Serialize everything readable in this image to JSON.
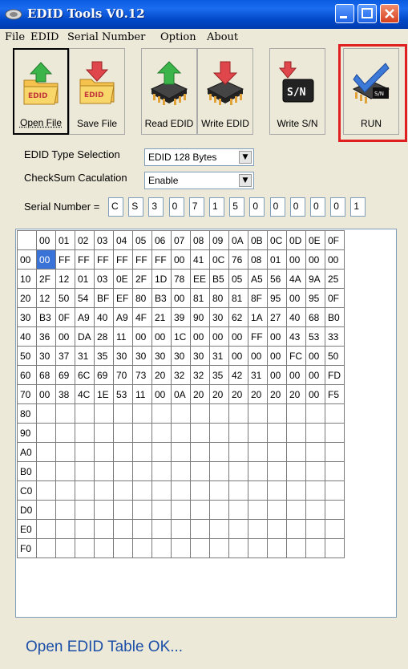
{
  "window": {
    "title": "EDID Tools V0.12"
  },
  "menu": [
    "File",
    "EDID",
    "Serial Number",
    "Option",
    "About"
  ],
  "toolbar": [
    {
      "label": "Open File",
      "icon": "folder-edid-up-icon"
    },
    {
      "label": "Save File",
      "icon": "folder-edid-down-icon"
    },
    {
      "label": "Read EDID",
      "icon": "chip-up-icon"
    },
    {
      "label": "Write EDID",
      "icon": "chip-down-icon"
    },
    {
      "label": "Write S/N",
      "icon": "sn-write-icon"
    },
    {
      "label": "RUN",
      "icon": "run-check-icon"
    }
  ],
  "form": {
    "edid_type_label": "EDID Type Selection",
    "edid_type_value": "EDID 128 Bytes",
    "checksum_label": "CheckSum Caculation",
    "checksum_value": "Enable",
    "serial_label": "Serial Number =",
    "serial_chars": [
      "C",
      "S",
      "3",
      "0",
      "7",
      "1",
      "5",
      "0",
      "0",
      "0",
      "0",
      "0",
      "1"
    ]
  },
  "table": {
    "col_headers": [
      "00",
      "01",
      "02",
      "03",
      "04",
      "05",
      "06",
      "07",
      "08",
      "09",
      "0A",
      "0B",
      "0C",
      "0D",
      "0E",
      "0F"
    ],
    "row_headers": [
      "00",
      "10",
      "20",
      "30",
      "40",
      "50",
      "60",
      "70",
      "80",
      "90",
      "A0",
      "B0",
      "C0",
      "D0",
      "E0",
      "F0"
    ],
    "rows": [
      [
        "00",
        "FF",
        "FF",
        "FF",
        "FF",
        "FF",
        "FF",
        "00",
        "41",
        "0C",
        "76",
        "08",
        "01",
        "00",
        "00",
        "00"
      ],
      [
        "2F",
        "12",
        "01",
        "03",
        "0E",
        "2F",
        "1D",
        "78",
        "EE",
        "B5",
        "05",
        "A5",
        "56",
        "4A",
        "9A",
        "25"
      ],
      [
        "12",
        "50",
        "54",
        "BF",
        "EF",
        "80",
        "B3",
        "00",
        "81",
        "80",
        "81",
        "8F",
        "95",
        "00",
        "95",
        "0F"
      ],
      [
        "B3",
        "0F",
        "A9",
        "40",
        "A9",
        "4F",
        "21",
        "39",
        "90",
        "30",
        "62",
        "1A",
        "27",
        "40",
        "68",
        "B0"
      ],
      [
        "36",
        "00",
        "DA",
        "28",
        "11",
        "00",
        "00",
        "1C",
        "00",
        "00",
        "00",
        "FF",
        "00",
        "43",
        "53",
        "33"
      ],
      [
        "30",
        "37",
        "31",
        "35",
        "30",
        "30",
        "30",
        "30",
        "30",
        "31",
        "00",
        "00",
        "00",
        "FC",
        "00",
        "50"
      ],
      [
        "68",
        "69",
        "6C",
        "69",
        "70",
        "73",
        "20",
        "32",
        "32",
        "35",
        "42",
        "31",
        "00",
        "00",
        "00",
        "FD"
      ],
      [
        "00",
        "38",
        "4C",
        "1E",
        "53",
        "11",
        "00",
        "0A",
        "20",
        "20",
        "20",
        "20",
        "20",
        "20",
        "00",
        "F5"
      ],
      [
        "",
        "",
        "",
        "",
        "",
        "",
        "",
        "",
        "",
        "",
        "",
        "",
        "",
        "",
        "",
        ""
      ],
      [
        "",
        "",
        "",
        "",
        "",
        "",
        "",
        "",
        "",
        "",
        "",
        "",
        "",
        "",
        "",
        ""
      ],
      [
        "",
        "",
        "",
        "",
        "",
        "",
        "",
        "",
        "",
        "",
        "",
        "",
        "",
        "",
        "",
        ""
      ],
      [
        "",
        "",
        "",
        "",
        "",
        "",
        "",
        "",
        "",
        "",
        "",
        "",
        "",
        "",
        "",
        ""
      ],
      [
        "",
        "",
        "",
        "",
        "",
        "",
        "",
        "",
        "",
        "",
        "",
        "",
        "",
        "",
        "",
        ""
      ],
      [
        "",
        "",
        "",
        "",
        "",
        "",
        "",
        "",
        "",
        "",
        "",
        "",
        "",
        "",
        "",
        ""
      ],
      [
        "",
        "",
        "",
        "",
        "",
        "",
        "",
        "",
        "",
        "",
        "",
        "",
        "",
        "",
        "",
        ""
      ],
      [
        "",
        "",
        "",
        "",
        "",
        "",
        "",
        "",
        "",
        "",
        "",
        "",
        "",
        "",
        "",
        ""
      ]
    ]
  },
  "status": "Open EDID Table OK...",
  "colors": {
    "title_bar": "#0a5be0",
    "highlight_box": "#e02020",
    "status_text": "#1c4fa8",
    "selected_cell": "#3a73d8"
  }
}
